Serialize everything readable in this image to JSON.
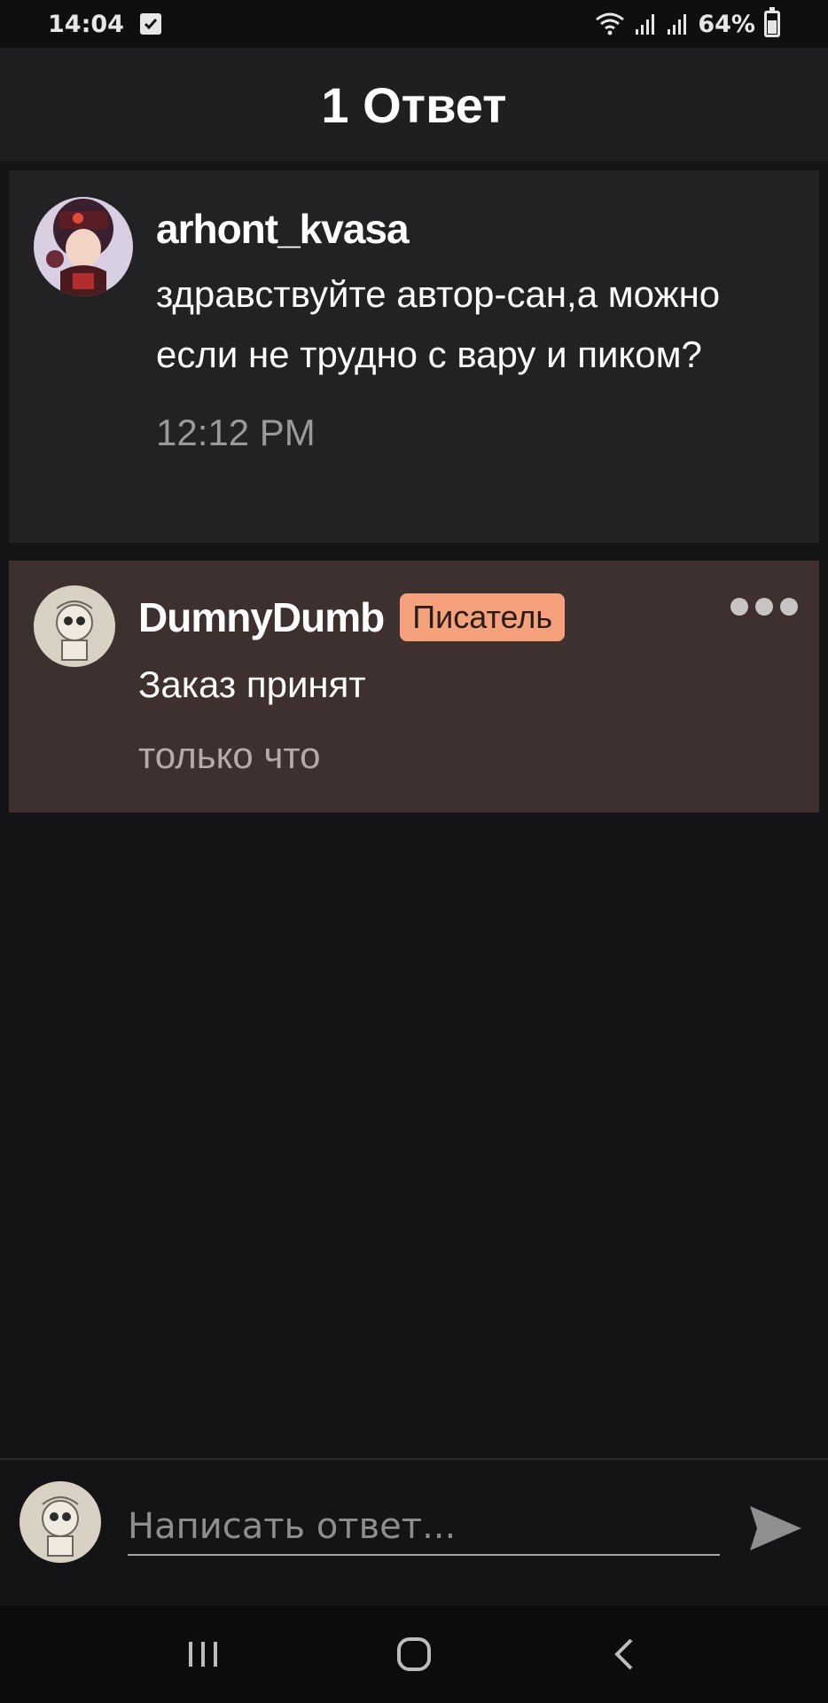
{
  "status_bar": {
    "time": "14:04",
    "battery": "64%"
  },
  "header": {
    "title": "1 Ответ"
  },
  "original_comment": {
    "author": "arhont_kvasa",
    "text": "здравствуйте автор-сан,а можно если не трудно с вару и пиком?",
    "time": "12:12 PM"
  },
  "reply_comment": {
    "author": "DumnyDumb",
    "badge": "Писатель",
    "text": "Заказ принят",
    "time": "только что"
  },
  "input": {
    "placeholder": "Написать ответ..."
  },
  "colors": {
    "background": "#151417",
    "header": "#1f1e21",
    "reply_highlight": "#3d302f",
    "badge": "#f5a27c"
  }
}
